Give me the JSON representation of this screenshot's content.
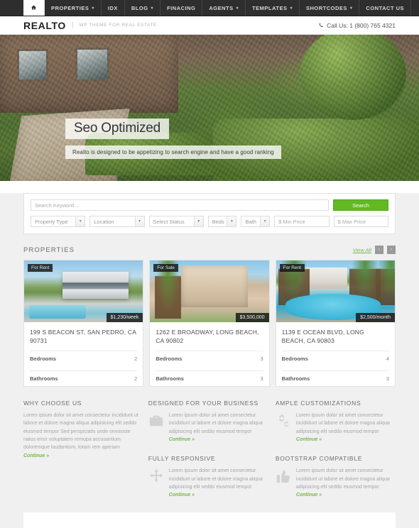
{
  "nav": {
    "home_icon": "home-icon",
    "items": [
      {
        "label": "PROPERTIES",
        "caret": true
      },
      {
        "label": "IDX",
        "caret": false
      },
      {
        "label": "BLOG",
        "caret": true
      },
      {
        "label": "FINACING",
        "caret": false
      },
      {
        "label": "AGENTS",
        "caret": true
      },
      {
        "label": "TEMPLATES",
        "caret": true
      },
      {
        "label": "SHORTCODES",
        "caret": true
      },
      {
        "label": "CONTACT US",
        "caret": false
      }
    ]
  },
  "header": {
    "logo": "REALTO",
    "separator": "|",
    "tagline": "WP THEME FOR REAL ESTATE",
    "phone_icon": "phone-icon",
    "phone": "Call Us: 1 (800) 765 4321"
  },
  "hero": {
    "title": "Seo Optimized",
    "subtitle": "Realto is designed to be appetizing to search engine and have a good ranking"
  },
  "search": {
    "keyword_placeholder": "Search Keyword...",
    "submit_label": "Search",
    "property_type": "Property Type",
    "location": "Location",
    "status": "Select Status",
    "beds": "Beds",
    "baths": "Bath",
    "min_price": "$ Min Price",
    "max_price": "$ Max Price"
  },
  "properties_section": {
    "title": "PROPERTIES",
    "view_all": "View All",
    "prev": "‹",
    "next": "›"
  },
  "properties": [
    {
      "badge": "For Rent",
      "price": "$1,230/week",
      "address": "199 S BEACON ST, SAN PEDRO, CA 90731",
      "bedrooms_label": "Bedrooms",
      "bedrooms": "2",
      "bathrooms_label": "Bathrooms",
      "bathrooms": "2"
    },
    {
      "badge": "For Sale",
      "price": "$3,500,000",
      "address": "1262 E BROADWAY, LONG BEACH, CA 90802",
      "bedrooms_label": "Bedrooms",
      "bedrooms": "3",
      "bathrooms_label": "Bathrooms",
      "bathrooms": "3"
    },
    {
      "badge": "For Rent",
      "price": "$2,500/month",
      "address": "1139 E OCEAN BLVD, LONG BEACH, CA 90803",
      "bedrooms_label": "Bedrooms",
      "bedrooms": "4",
      "bathrooms_label": "Bathrooms",
      "bathrooms": "3"
    }
  ],
  "features": {
    "why": {
      "title": "WHY CHOOSE US",
      "text": "Lorem ipsum dolor sit amet consectetur incididunt ut labore et dolore magna aliqua adipisicing elit seddo eiusmod tempor Sed perspiciatis unde omnisiste natus error voluptatem remopa accusantium doloremque laudantium, totam rem aperiam ",
      "continue": "Continue »"
    },
    "business": {
      "title": "DESIGNED FOR YOUR BUSINESS",
      "icon": "briefcase-icon",
      "text": "Lorem ipsum dolor sit amet consectetur incididunt ut labore et dolore magna aliqua adipisicing elit seddo eiusmod tempor ",
      "continue": "Continue »"
    },
    "responsive": {
      "title": "FULLY RESPONSIVE",
      "icon": "arrows-move-icon",
      "text": "Lorem ipsum dolor sit amet consectetur incididunt ut labore et dolore magna aliqua adipisicing elit seddo eiusmod tempor ",
      "continue": "Continue »"
    },
    "customizations": {
      "title": "AMPLE CUSTOMIZATIONS",
      "icon": "gears-icon",
      "text": "Lorem ipsum dolor sit amet consectetur incididunt ut labore et dolore magna aliqua adipisicing elit seddo eiusmod tempor ",
      "continue": "Continue »"
    },
    "bootstrap": {
      "title": "BOOTSTRAP COMPATIBLE",
      "icon": "thumbs-up-icon",
      "text": "Lorem ipsum dolor sit amet consectetur incididunt ut labore et dolore magna aliqua adipisicing elit seddo eiusmod tempor ",
      "continue": "Continue »"
    }
  },
  "colors": {
    "accent_green": "#7ab648",
    "button_green": "#62b921",
    "nav_dark": "#2e2e2e",
    "page_bg": "#f0f0f0"
  }
}
